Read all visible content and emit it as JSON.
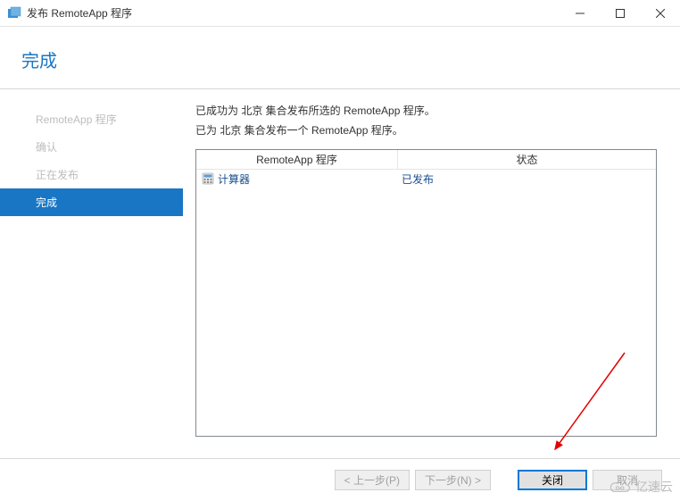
{
  "window": {
    "title": "发布 RemoteApp 程序"
  },
  "page": {
    "title": "完成"
  },
  "sidebar": {
    "items": [
      {
        "label": "RemoteApp 程序"
      },
      {
        "label": "确认"
      },
      {
        "label": "正在发布"
      },
      {
        "label": "完成"
      }
    ]
  },
  "content": {
    "line1": "已成功为 北京 集合发布所选的 RemoteApp 程序。",
    "line2": "已为 北京 集合发布一个 RemoteApp 程序。"
  },
  "table": {
    "headers": {
      "col1": "RemoteApp 程序",
      "col2": "状态"
    },
    "rows": [
      {
        "name": "计算器",
        "status": "已发布"
      }
    ]
  },
  "footer": {
    "prev": "< 上一步(P)",
    "next": "下一步(N) >",
    "close": "关闭",
    "cancel": "取消"
  },
  "watermark": "亿速云"
}
